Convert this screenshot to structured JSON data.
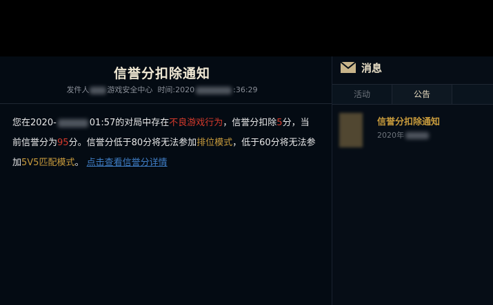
{
  "message": {
    "title": "信誉分扣除通知",
    "meta": {
      "sender_prefix": "发件人",
      "sender_suffix": "游戏安全中心",
      "time_prefix": "时间:2020",
      "time_suffix": ":36:29"
    },
    "body": {
      "part1": "您在2020-",
      "part2": "01:57的对局中存在",
      "bad_behavior": "不良游戏行为",
      "part3": "，信誉分扣除",
      "deducted": "5",
      "part4": "分，当前信誉分为",
      "current_score": "95",
      "part5": "分。信誉分低于80分将无法参加",
      "ranked_mode": "排位模式",
      "part6": "，低于60分将无法参加",
      "mode_5v5": "5V5匹配模式",
      "part7": "。",
      "details_link": "点击查看信誉分详情"
    }
  },
  "sidebar": {
    "title": "消息",
    "tabs": [
      {
        "label": "活动",
        "active": false
      },
      {
        "label": "公告",
        "active": true
      }
    ],
    "items": [
      {
        "title": "信誉分扣除通知",
        "date": "2020年"
      }
    ]
  },
  "colors": {
    "background": "#030a12",
    "highlight_red": "#d63a2c",
    "highlight_gold": "#c89b3c",
    "link_blue": "#3f7ec6"
  }
}
